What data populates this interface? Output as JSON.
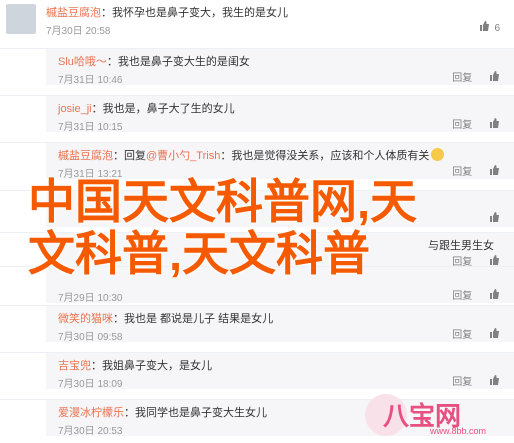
{
  "comments": [
    {
      "user": "槭盐豆腐泡",
      "text": "：我怀孕也是鼻子变大，我生的是女儿",
      "date": "7月30日 20:58",
      "reply_label": "",
      "like_count": "6",
      "sub": false
    },
    {
      "user": "Slu哈哦～",
      "text": "：我也是鼻子变大生的是闺女",
      "date": "7月31日 10:46",
      "reply_label": "回复",
      "like_count": "",
      "sub": true
    },
    {
      "user": "josie_ji",
      "text": "：我也是，鼻子大了生的女儿",
      "date": "7月31日 10:15",
      "reply_label": "回复",
      "like_count": "",
      "sub": true
    },
    {
      "user": "槭盐豆腐泡",
      "text_prefix": "：回复",
      "text_mention": "@曹小勺_Trish",
      "text_rest": "：我也是觉得没关系，应该和个人体质有关",
      "date": "7月31日 13:21",
      "reply_label": "回复",
      "like_count": "",
      "sub": true
    },
    {
      "user": "",
      "text": "",
      "date": "",
      "reply_label": "",
      "like_count": "",
      "sub": true
    },
    {
      "user": "",
      "text": "",
      "date": "",
      "reply_label": "回复",
      "like_count": "",
      "sub": true
    },
    {
      "user": "",
      "text": "",
      "date": "7月29日 10:30",
      "reply_label": "回复",
      "like_count": "",
      "sub": true
    },
    {
      "user": "微笑的猫咪",
      "text": "：我也是 都说是儿子 结果是女儿",
      "date": "7月30日 09:58",
      "reply_label": "回复",
      "like_count": "",
      "sub": true
    },
    {
      "user": "吉宝兜",
      "text": "：我姐鼻子变大，是女儿",
      "date": "7月30日 18:09",
      "reply_label": "回复",
      "like_count": "",
      "sub": true
    },
    {
      "user": "爱漫冰柠檬乐",
      "text": "：我同学也是鼻子变大生女儿",
      "date": "7月30日 20:53",
      "reply_label": "",
      "like_count": "",
      "sub": true
    }
  ],
  "overlay": {
    "line1": "中国天文科普网,天",
    "line2": "文科普,天文科普"
  },
  "partial_text": {
    "row5": "与跟生男生女",
    "row6": "跟生"
  },
  "watermark": {
    "main": "八宝网",
    "sub": "www.8bb.com"
  },
  "colors": {
    "username": "#eb7350",
    "overlay": "#f55a00",
    "watermark": "#e75080"
  }
}
